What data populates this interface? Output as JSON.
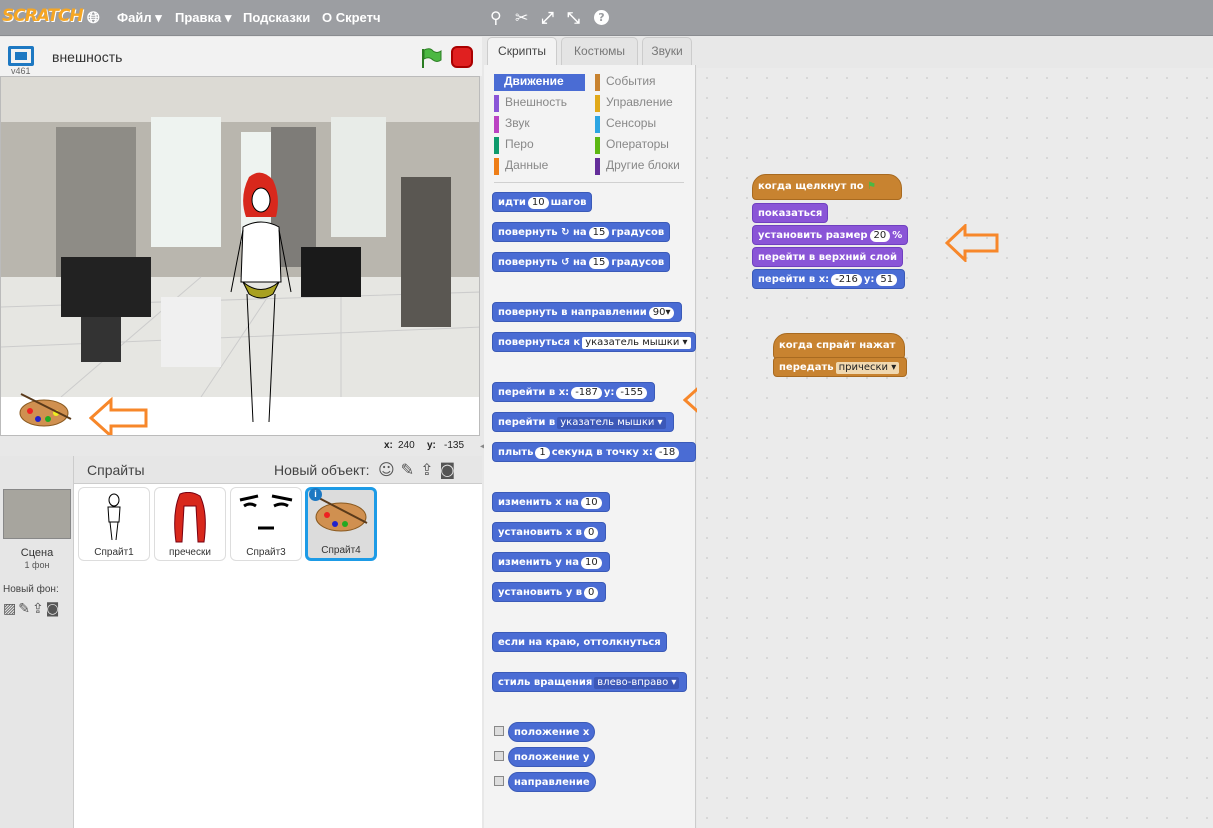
{
  "topbar": {
    "logo": "SCRATCH",
    "menus": [
      "Файл ▾",
      "Правка ▾",
      "Подсказки",
      "О Скретч"
    ]
  },
  "stage": {
    "sprite_name": "внешность",
    "version": "v461",
    "x_label": "x:",
    "x_value": "240",
    "y_label": "y:",
    "y_value": "-135"
  },
  "sprites": {
    "title": "Спрайты",
    "new_object": "Новый объект:",
    "items": [
      "Спрайт1",
      "пречески",
      "Спрайт3",
      "Спрайт4"
    ],
    "scene_label": "Сцена",
    "scene_sub": "1 фон",
    "new_backdrop": "Новый фон:"
  },
  "tabs": [
    "Скрипты",
    "Костюмы",
    "Звуки"
  ],
  "categories": [
    "Движение",
    "События",
    "Внешность",
    "Управление",
    "Звук",
    "Сенсоры",
    "Перо",
    "Операторы",
    "Данные",
    "Другие блоки"
  ],
  "palette": {
    "move": {
      "a": "идти",
      "n": "10",
      "b": "шагов"
    },
    "turn_r": {
      "a": "повернуть",
      "b": "на",
      "n": "15",
      "c": "градусов"
    },
    "turn_l": {
      "a": "повернуть",
      "b": "на",
      "n": "15",
      "c": "градусов"
    },
    "point_dir": {
      "a": "повернуть в направлении",
      "n": "90▾"
    },
    "point_towards": {
      "a": "повернуться к",
      "d": "указатель мышки ▾"
    },
    "goto_xy": {
      "a": "перейти в x:",
      "x": "-187",
      "b": "y:",
      "y": "-155"
    },
    "goto": {
      "a": "перейти в",
      "d": "указатель мышки ▾"
    },
    "glide": {
      "a": "плыть",
      "n": "1",
      "b": "секунд в точку x:",
      "x": "-18"
    },
    "change_x": {
      "a": "изменить х на",
      "n": "10"
    },
    "set_x": {
      "a": "установить х в",
      "n": "0"
    },
    "change_y": {
      "a": "изменить у на",
      "n": "10"
    },
    "set_y": {
      "a": "установить у в",
      "n": "0"
    },
    "bounce": "если на краю, оттолкнуться",
    "rot_style": {
      "a": "стиль вращения",
      "d": "влево-вправо ▾"
    },
    "rep_x": "положение x",
    "rep_y": "положение y",
    "rep_dir": "направление"
  },
  "scripts": {
    "s1": {
      "hat": "когда щелкнут по",
      "show": "показаться",
      "size_a": "установить размер",
      "size_n": "20",
      "size_b": "%",
      "front": "перейти в верхний слой",
      "goto_a": "перейти в x:",
      "goto_x": "-216",
      "goto_b": "y:",
      "goto_y": "51"
    },
    "s2": {
      "hat": "когда спрайт нажат",
      "bc_a": "передать",
      "bc_d": "прически ▾"
    }
  },
  "colors": {
    "motion": "#4a6cd4",
    "looks": "#8a55d7",
    "events": "#c88330",
    "arrow": "#f7872a"
  }
}
